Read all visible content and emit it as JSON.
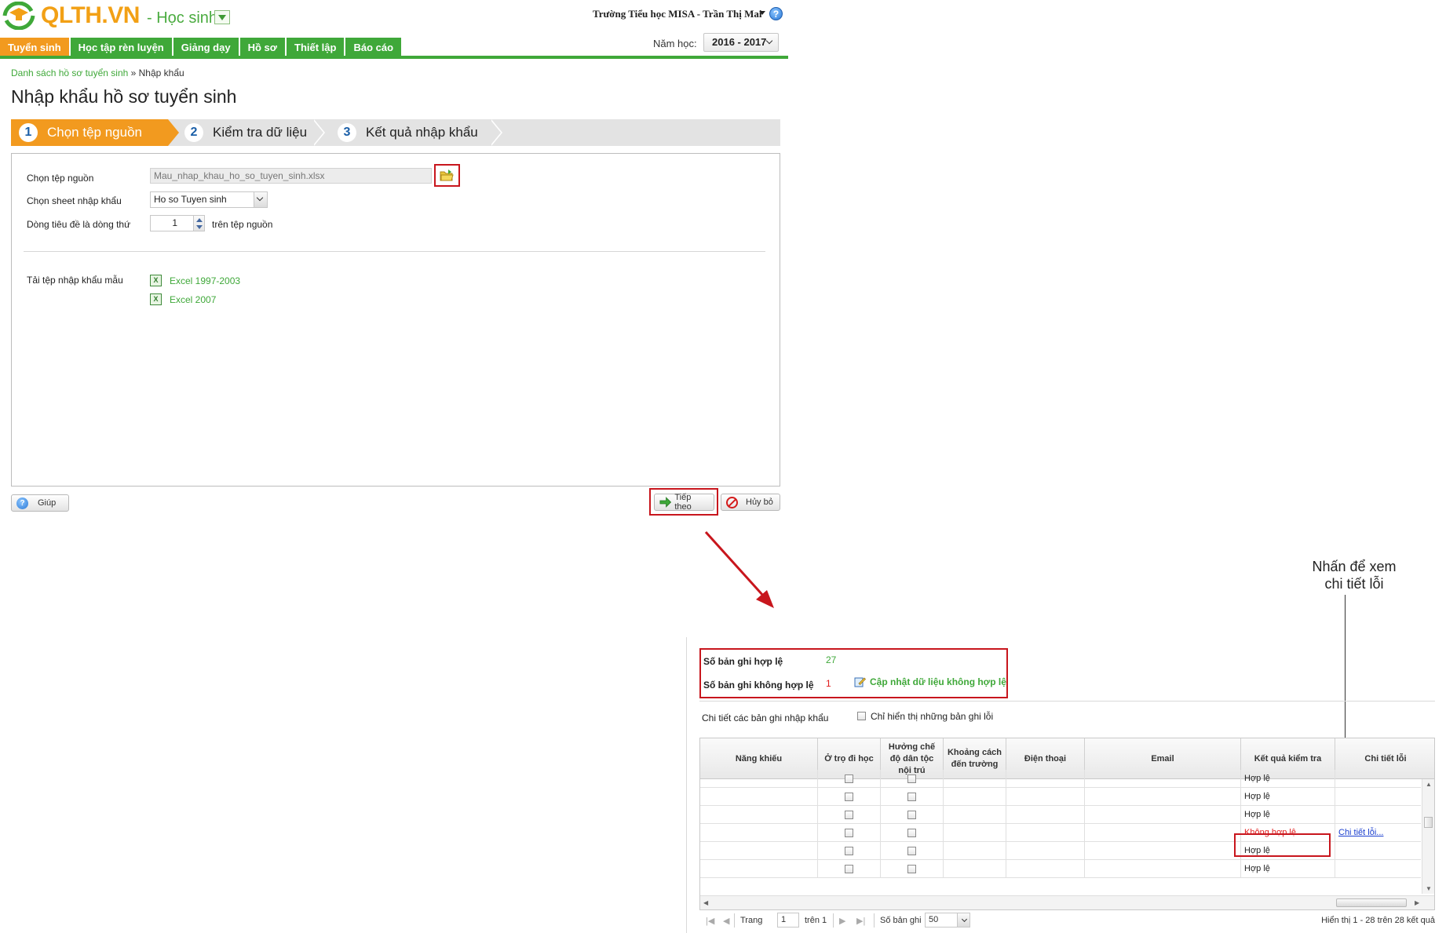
{
  "header": {
    "logo_text": "QLTH.VN",
    "role": "- Học sinh",
    "user_line": "Trường Tiểu học MISA - Trần Thị Mai",
    "help_glyph": "?",
    "year_label": "Năm học:",
    "year_value": "2016 - 2017"
  },
  "menu": [
    {
      "label": "Tuyển sinh",
      "active": true
    },
    {
      "label": "Học tập rèn luyện",
      "active": false
    },
    {
      "label": "Giảng dạy",
      "active": false
    },
    {
      "label": "Hồ sơ",
      "active": false
    },
    {
      "label": "Thiết lập",
      "active": false
    },
    {
      "label": "Báo cáo",
      "active": false
    }
  ],
  "breadcrumb": {
    "parent": "Danh sách hồ sơ tuyển sinh",
    "separator": " » ",
    "current": "Nhập khẩu"
  },
  "page_title": "Nhập khẩu hồ sơ tuyển sinh",
  "steps": [
    {
      "num": "1",
      "label": "Chọn tệp nguồn"
    },
    {
      "num": "2",
      "label": "Kiểm tra dữ liệu"
    },
    {
      "num": "3",
      "label": "Kết quả nhập khẩu"
    }
  ],
  "form": {
    "source_label": "Chọn tệp nguồn",
    "source_value": "Mau_nhap_khau_ho_so_tuyen_sinh.xlsx",
    "sheet_label": "Chọn sheet nhập khẩu",
    "sheet_value": "Ho so Tuyen sinh",
    "header_row_label": "Dòng tiêu đề là dòng thứ",
    "header_row_value": "1",
    "header_row_suffix": "trên tệp nguồn",
    "template_label": "Tải tệp nhập khẩu mẫu",
    "templates": [
      "Excel 1997-2003",
      "Excel 2007"
    ]
  },
  "buttons": {
    "help": "Giúp",
    "next": "Tiếp theo",
    "cancel": "Hủy bỏ"
  },
  "callout": "Nhấn để xem chi tiết lỗi",
  "result": {
    "valid_label": "Số bản ghi hợp lệ",
    "valid_count": "27",
    "invalid_label": "Số bản ghi không hợp lệ",
    "invalid_count": "1",
    "update_link": "Cập nhật dữ liệu không hợp lệ",
    "detail_label": "Chi tiết các bản ghi nhập khẩu",
    "errors_only_label": "Chỉ hiển thị những bản ghi lỗi",
    "columns": [
      "Năng khiếu",
      "Ở trọ đi học",
      "Hưởng chế độ dân tộc nội trú",
      "Khoảng cách đến trường",
      "Điện thoại",
      "Email",
      "Kết quả kiểm tra",
      "Chi tiết lỗi"
    ],
    "rows": [
      {
        "ket_qua": "Hợp lệ",
        "chi_tiet": "",
        "invalid": false
      },
      {
        "ket_qua": "Hợp lệ",
        "chi_tiet": "",
        "invalid": false
      },
      {
        "ket_qua": "Hợp lệ",
        "chi_tiet": "",
        "invalid": false
      },
      {
        "ket_qua": "Không hợp lệ",
        "chi_tiet": "Chi tiết lỗi...",
        "invalid": true
      },
      {
        "ket_qua": "Hợp lệ",
        "chi_tiet": "",
        "invalid": false
      },
      {
        "ket_qua": "Hợp lệ",
        "chi_tiet": "",
        "invalid": false
      }
    ],
    "pager": {
      "page_label": "Trang",
      "page_value": "1",
      "of_label": "trên 1",
      "size_label": "Số bản ghi",
      "size_value": "50",
      "summary": "Hiển thị 1 - 28 trên 28 kết quả"
    }
  },
  "colors": {
    "brand_green": "#3fa839",
    "brand_orange": "#f29a1f",
    "highlight_red": "#c8161d"
  },
  "icons": [
    "logo-cap-icon",
    "help-icon",
    "folder-open-icon",
    "excel-icon",
    "next-arrow-icon",
    "cancel-icon",
    "edit-note-icon",
    "first-page-icon",
    "prev-page-icon",
    "next-page-icon",
    "last-page-icon"
  ]
}
